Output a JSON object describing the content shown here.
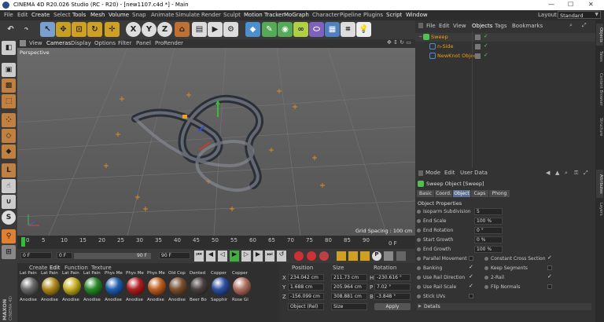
{
  "window": {
    "title": "CINEMA 4D R20.026 Studio (RC - R20) - [new1107.c4d *] - Main"
  },
  "menu": {
    "items": [
      "File",
      "Edit",
      "Create",
      "Select",
      "Tools",
      "Mesh",
      "Volume",
      "Snap",
      "Animate",
      "Simulate",
      "Render",
      "Sculpt",
      "Motion Tracker",
      "MoGraph",
      "Character",
      "Pipeline",
      "Plugins",
      "Script",
      "Window"
    ],
    "layout_label": "Layout:",
    "layout_value": "Standard"
  },
  "viewport": {
    "menu": [
      "View",
      "Cameras",
      "Display",
      "Options",
      "Filter",
      "Panel",
      "ProRender"
    ],
    "camera": "Perspective",
    "grid_spacing": "Grid Spacing : 100 cm"
  },
  "timeline": {
    "ticks": [
      "0",
      "5",
      "10",
      "15",
      "20",
      "25",
      "30",
      "35",
      "40",
      "45",
      "50",
      "55",
      "60",
      "65",
      "70",
      "75",
      "80",
      "85",
      "90"
    ],
    "end_frame": "0 F"
  },
  "transport": {
    "start": "0 F",
    "current": "0 F",
    "end_range": "90 F",
    "end": "90 F"
  },
  "materials": {
    "menu": [
      "Create",
      "Edit",
      "Function",
      "Texture"
    ],
    "items": [
      {
        "top": "Lat Pain",
        "bottom": "Anodise",
        "color": "#6a6a6a"
      },
      {
        "top": "Lat Pain",
        "bottom": "Anodise",
        "color": "#b08a1a"
      },
      {
        "top": "Lat Pain",
        "bottom": "Anodise",
        "color": "#c8b020"
      },
      {
        "top": "Lat Pain",
        "bottom": "Anodise",
        "color": "#2a8a2a"
      },
      {
        "top": "Phys Me",
        "bottom": "Anodise",
        "color": "#2060b0"
      },
      {
        "top": "Phys Me",
        "bottom": "Anodise",
        "color": "#b02020"
      },
      {
        "top": "Phys Me",
        "bottom": "Anodise",
        "color": "#c06020"
      },
      {
        "top": "Old Cop",
        "bottom": "Anodise",
        "color": "#7a5030"
      },
      {
        "top": "Dented",
        "bottom": "Beer Bo",
        "color": "#4a4040"
      },
      {
        "top": "Copper",
        "bottom": "Sapphir",
        "color": "#3050a0"
      },
      {
        "top": "Copper",
        "bottom": "Rose Gl",
        "color": "#b07060"
      }
    ]
  },
  "coords": {
    "headers": [
      "Position",
      "Size",
      "Rotation"
    ],
    "rows": [
      {
        "axis": "X",
        "pos": "234.042 cm",
        "size": "211.73 cm",
        "rot_axis": "H",
        "rot": "-230.616 °"
      },
      {
        "axis": "Y",
        "pos": "1.688 cm",
        "size": "205.964 cm",
        "rot_axis": "P",
        "rot": "7.02 °"
      },
      {
        "axis": "Z",
        "pos": "-156.099 cm",
        "size": "308.881 cm",
        "rot_axis": "B",
        "rot": "-3.848 °"
      }
    ],
    "mode": "Object (Rel)",
    "size_mode": "Size",
    "apply": "Apply"
  },
  "objects": {
    "tabs": [
      "File",
      "Edit",
      "View",
      "Objects",
      "Tags",
      "Bookmarks"
    ],
    "items": [
      {
        "name": "Sweep",
        "indent": 0,
        "color": "#f0a000"
      },
      {
        "name": "n-Side",
        "indent": 1,
        "color": "#f0a000"
      },
      {
        "name": "NewKnot Object",
        "indent": 1,
        "color": "#f0a000"
      }
    ]
  },
  "attributes": {
    "menu": [
      "Mode",
      "Edit",
      "User Data"
    ],
    "title": "Sweep Object [Sweep]",
    "tabs": [
      "Basic",
      "Coord.",
      "Object",
      "Caps",
      "Phong"
    ],
    "active_tab": "Object",
    "section": "Object Properties",
    "props": [
      {
        "name": "Isoparm Subdivision",
        "value": "5"
      },
      {
        "name": "End Scale",
        "value": "100 %"
      },
      {
        "name": "End Rotation",
        "value": "0 °"
      },
      {
        "name": "Start Growth",
        "value": "0 %"
      },
      {
        "name": "End Growth",
        "value": "100 %"
      }
    ],
    "checks_left": [
      "Parallel Movement",
      "Banking",
      "Use Rail Direction",
      "Use Rail Scale",
      "Stick UVs"
    ],
    "checks_right": [
      "Constant Cross Section",
      "Keep Segments",
      "2-Rail",
      "Flip Normals"
    ],
    "details": "Details"
  },
  "right_tabs": [
    "Objects",
    "Takes",
    "Content Browser",
    "Structure",
    "Attributes",
    "Layers"
  ],
  "brand": {
    "line1": "MAXON",
    "line2": "CINEMA 4D"
  }
}
